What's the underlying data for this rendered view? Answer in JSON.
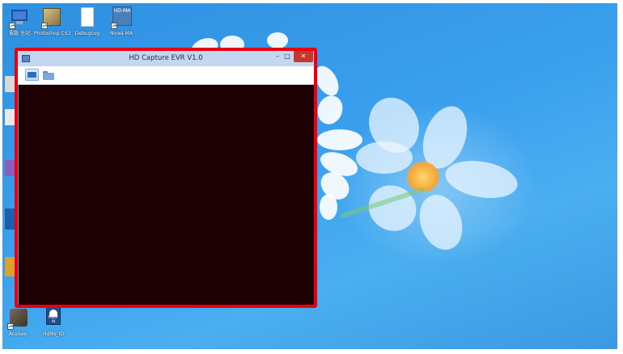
{
  "desktop": {
    "icons": [
      {
        "label": "電腦 住記",
        "icon": "computer-icon"
      },
      {
        "label": "Photoshop CS3",
        "icon": "photoshop-icon"
      },
      {
        "label": "DebugLog",
        "icon": "document-icon"
      },
      {
        "label": "Nowa MA",
        "icon": "hdma-icon"
      },
      {
        "label": "AceSee",
        "icon": "app-icon"
      },
      {
        "label": "HdMs_ID",
        "icon": "plugin-icon"
      }
    ],
    "plugin_badge": "PLUG-IN",
    "hdma_badge": "HD-MA"
  },
  "window": {
    "title": "HD Capture EVR V1.0",
    "min_glyph": "–",
    "max_glyph": "□",
    "close_glyph": "✕",
    "tools": [
      {
        "icon": "capture-icon"
      },
      {
        "icon": "folder-icon"
      }
    ],
    "highlight_color": "#e60012",
    "preview_color": "#1e0102"
  }
}
